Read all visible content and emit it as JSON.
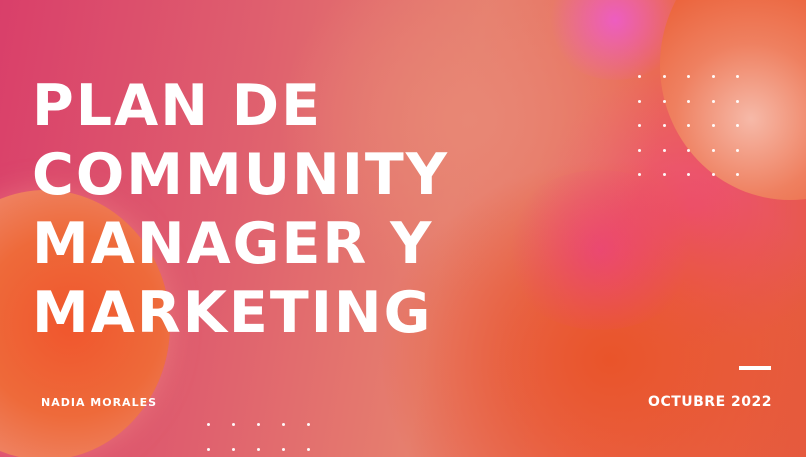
{
  "slide": {
    "title_lines": [
      "PLAN DE",
      "COMMUNITY",
      "MANAGER Y",
      "MARKETING"
    ],
    "author": "NADIA MORALES",
    "date": "OCTUBRE 2022"
  },
  "colors": {
    "background_left": "#d93f6a",
    "background_center": "#e67f6e",
    "accent_orange": "#e9542a",
    "accent_pink": "#ee5ad2",
    "text": "#ffffff"
  }
}
